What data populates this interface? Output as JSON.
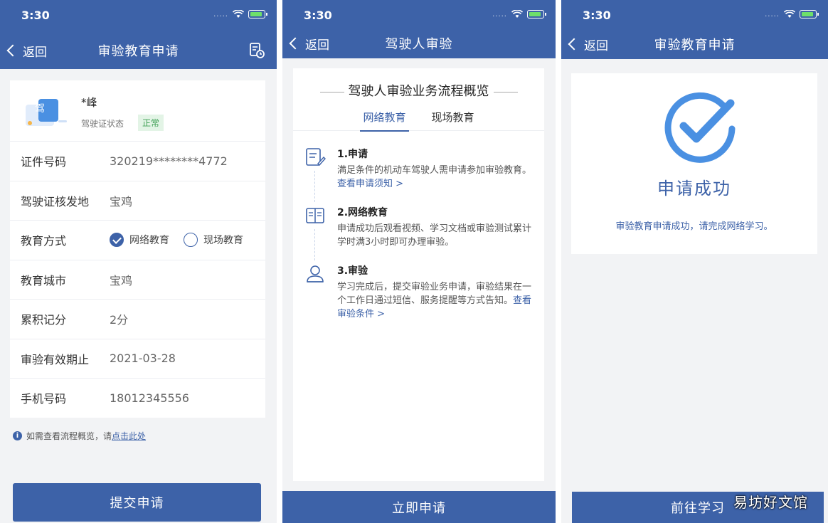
{
  "status": {
    "time": "3:30",
    "signal_dots": "....."
  },
  "nav": {
    "back_label": "返回"
  },
  "panel1": {
    "title": "审验教育申请",
    "profile": {
      "name": "*峰",
      "license_glyph": "驾",
      "status_label": "驾驶证状态",
      "status_value": "正常"
    },
    "rows": [
      {
        "label": "证件号码",
        "value": "320219********4772"
      },
      {
        "label": "驾驶证核发地",
        "value": "宝鸡"
      },
      {
        "label": "教育方式",
        "options": [
          "网络教育",
          "现场教育"
        ],
        "selected": "网络教育"
      },
      {
        "label": "教育城市",
        "value": "宝鸡"
      },
      {
        "label": "累积记分",
        "value": "2分"
      },
      {
        "label": "审验有效期止",
        "value": "2021-03-28"
      },
      {
        "label": "手机号码",
        "value": "18012345556"
      }
    ],
    "hint": {
      "prefix": "如需查看流程概览，请",
      "link": "点击此处"
    },
    "submit_label": "提交申请"
  },
  "panel2": {
    "title": "驾驶人审验",
    "overview_title": "驾驶人审验业务流程概览",
    "tabs": [
      "网络教育",
      "现场教育"
    ],
    "active_tab": "网络教育",
    "steps": [
      {
        "title": "1.申请",
        "desc": "满足条件的机动车驾驶人需申请参加审验教育。",
        "link": "查看申请须知 >",
        "icon": "form-edit-icon"
      },
      {
        "title": "2.网络教育",
        "desc": "申请成功后观看视频、学习文档或审验测试累计学时满3小时即可办理审验。",
        "link": "",
        "icon": "book-icon"
      },
      {
        "title": "3.审验",
        "desc": "学习完成后，提交审验业务申请，审验结果在一个工作日通过短信、服务提醒等方式告知。",
        "link": "查看审验条件 >",
        "icon": "user-badge-icon"
      }
    ],
    "apply_label": "立即申请"
  },
  "panel3": {
    "title": "审验教育申请",
    "success_title": "申请成功",
    "success_message": "审验教育申请成功，请完成网络学习。",
    "go_label": "前往学习",
    "watermark": "易坊好文馆"
  },
  "colors": {
    "primary": "#3d62a8",
    "success_check": "#4a90e2",
    "badge_green": "#3f9f55"
  }
}
